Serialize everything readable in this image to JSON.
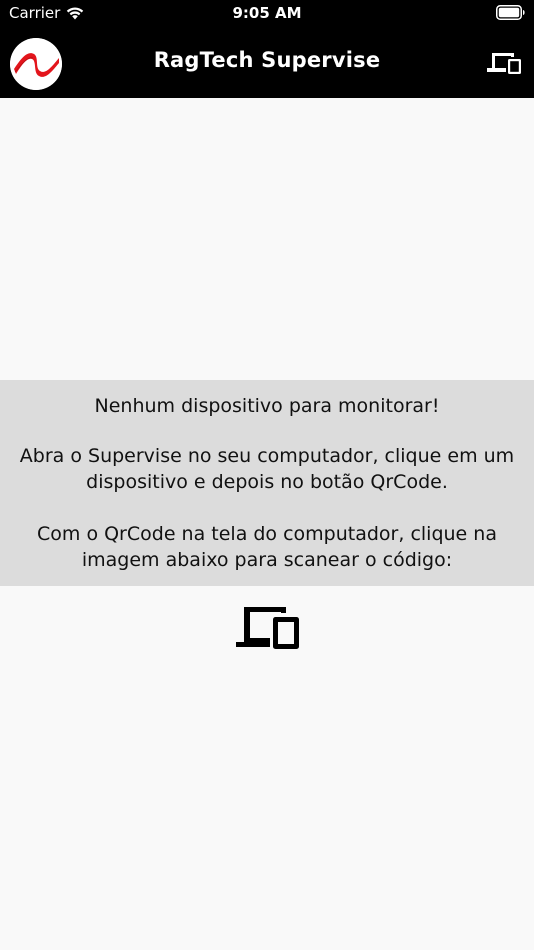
{
  "status_bar": {
    "carrier": "Carrier",
    "time": "9:05 AM"
  },
  "navbar": {
    "title": "RagTech Supervise",
    "logo_color": "#e3151c",
    "background": "#000000"
  },
  "message": {
    "line1": "Nenhum dispositivo para monitorar!",
    "para2": "Abra o Supervise no seu computador, clique em um dispositivo e depois no botão QrCode.",
    "para3": "Com o QrCode na tela do computador, clique na imagem abaixo para scanear o código:",
    "background": "#dcdcdc"
  },
  "icons": {
    "nav_right": "devices-icon",
    "scan": "devices-icon",
    "wifi": "wifi-icon",
    "battery": "battery-icon"
  }
}
